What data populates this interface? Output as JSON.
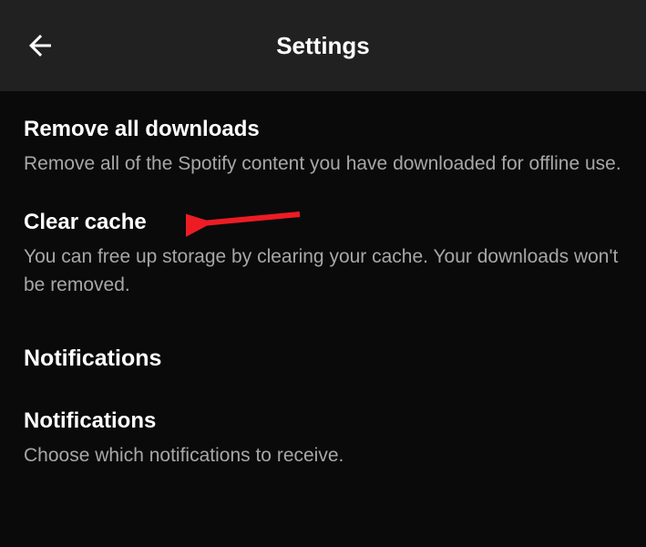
{
  "header": {
    "title": "Settings"
  },
  "settings": {
    "removeDownloads": {
      "title": "Remove all downloads",
      "description": "Remove all of the Spotify content you have downloaded for offline use."
    },
    "clearCache": {
      "title": "Clear cache",
      "description": "You can free up storage by clearing your cache. Your downloads won't be removed."
    },
    "notifications": {
      "title": "Notifications",
      "description": "Choose which notifications to receive."
    }
  },
  "sections": {
    "notifications": "Notifications"
  }
}
